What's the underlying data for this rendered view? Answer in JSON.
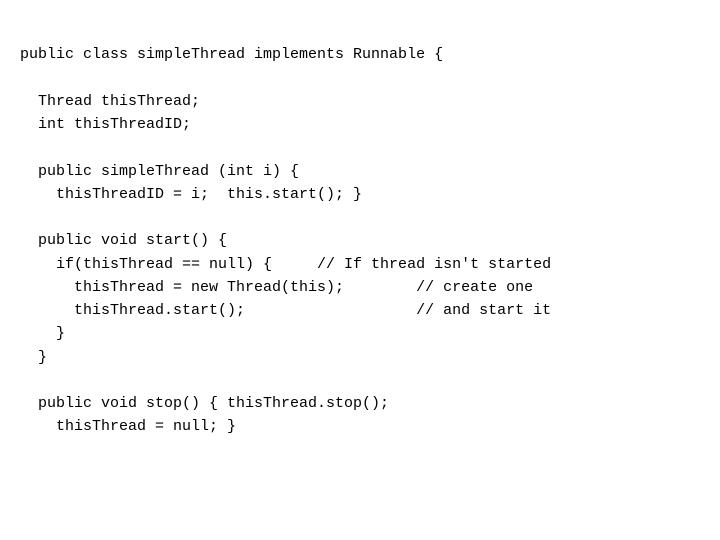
{
  "code": {
    "lines": [
      "public class simpleThread implements Runnable {",
      "",
      "  Thread thisThread;",
      "  int thisThreadID;",
      "",
      "  public simpleThread (int i) {",
      "    thisThreadID = i;  this.start(); }",
      "",
      "  public void start() {",
      "    if(thisThread == null) {     // If thread isn't started",
      "      thisThread = new Thread(this);        // create one",
      "      thisThread.start();                   // and start it",
      "    }",
      "  }",
      "",
      "  public void stop() { thisThread.stop();",
      "    thisThread = null; }",
      ""
    ]
  }
}
